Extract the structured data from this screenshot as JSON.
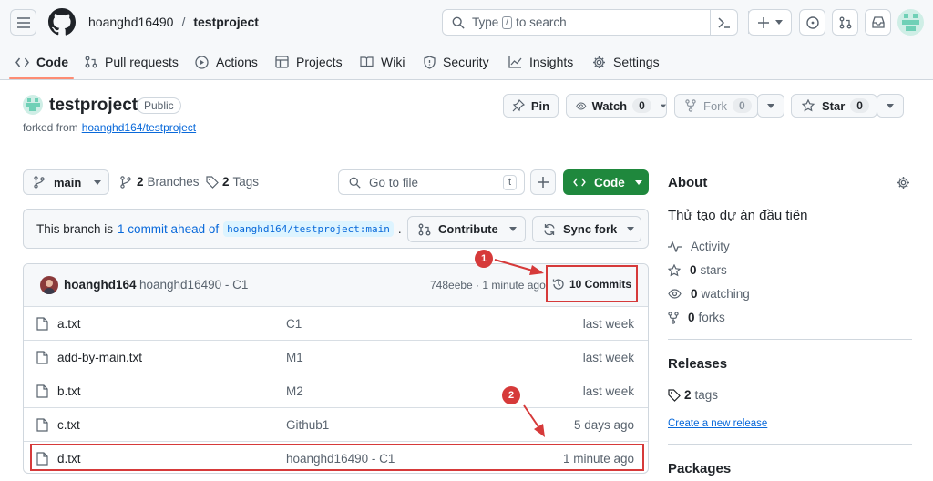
{
  "header": {
    "owner": "hoanghd16490",
    "separator": "/",
    "repo": "testproject",
    "search_placeholder_pre": "Type",
    "search_key": "/",
    "search_placeholder_post": "to search"
  },
  "tabs": [
    {
      "label": "Code",
      "icon": "code-icon",
      "active": true
    },
    {
      "label": "Pull requests",
      "icon": "pull-request-icon"
    },
    {
      "label": "Actions",
      "icon": "play-icon"
    },
    {
      "label": "Projects",
      "icon": "table-icon"
    },
    {
      "label": "Wiki",
      "icon": "book-icon"
    },
    {
      "label": "Security",
      "icon": "shield-icon"
    },
    {
      "label": "Insights",
      "icon": "graph-icon"
    },
    {
      "label": "Settings",
      "icon": "gear-icon"
    }
  ],
  "repo_header": {
    "name": "testproject",
    "visibility": "Public",
    "forked_from_label": "forked from",
    "forked_from_link": "hoanghd164/testproject",
    "pin_label": "Pin",
    "watch_label": "Watch",
    "watch_count": "0",
    "fork_label": "Fork",
    "fork_count": "0",
    "star_label": "Star",
    "star_count": "0"
  },
  "toolbar": {
    "branch": "main",
    "branches_count": "2",
    "branches_label": "Branches",
    "tags_count": "2",
    "tags_label": "Tags",
    "goto_placeholder": "Go to file",
    "goto_key": "t",
    "code_label": "Code"
  },
  "branch_notice": {
    "prefix": "This branch is",
    "link": "1 commit ahead of",
    "ref": "hoanghd164/testproject:main",
    "suffix": ".",
    "contribute_label": "Contribute",
    "sync_label": "Sync fork"
  },
  "latest_commit": {
    "author": "hoanghd164",
    "message": "hoanghd16490 - C1",
    "hash_time": "748eebe · 1 minute ago",
    "commits_label": "10 Commits"
  },
  "files": [
    {
      "name": "a.txt",
      "message": "C1",
      "time": "last week"
    },
    {
      "name": "add-by-main.txt",
      "message": "M1",
      "time": "last week"
    },
    {
      "name": "b.txt",
      "message": "M2",
      "time": "last week"
    },
    {
      "name": "c.txt",
      "message": "Github1",
      "time": "5 days ago"
    },
    {
      "name": "d.txt",
      "message": "hoanghd16490 - C1",
      "time": "1 minute ago"
    }
  ],
  "about": {
    "title": "About",
    "description": "Thử tạo dự án đầu tiên",
    "activity": "Activity",
    "stars_count": "0",
    "stars_label": "stars",
    "watching_count": "0",
    "watching_label": "watching",
    "forks_count": "0",
    "forks_label": "forks"
  },
  "releases": {
    "title": "Releases",
    "tags_count": "2",
    "tags_label": "tags",
    "create_link": "Create a new release"
  },
  "packages": {
    "title": "Packages"
  },
  "annotations": {
    "badge1": "1",
    "badge2": "2"
  },
  "colors": {
    "accent": "#0969da",
    "primary_btn": "#1f883d",
    "annotation": "#d63a3a"
  }
}
